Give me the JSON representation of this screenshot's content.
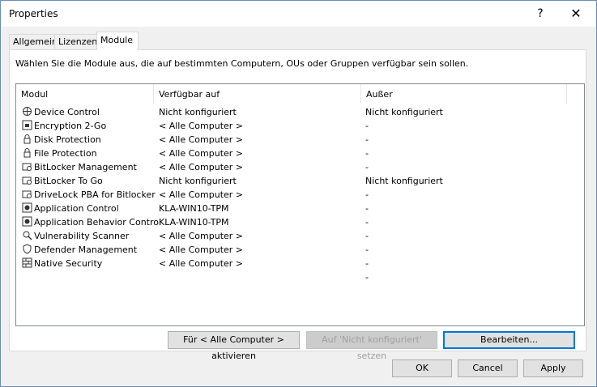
{
  "window": {
    "title": "Properties",
    "help_label": "?",
    "close_label": "✕"
  },
  "tabs": [
    {
      "label": "Allgemein",
      "active": false
    },
    {
      "label": "Lizenzen",
      "active": false
    },
    {
      "label": "Module",
      "active": true
    }
  ],
  "panel": {
    "instruction": "Wählen Sie die Module aus, die auf bestimmten Computern, OUs oder Gruppen verfügbar sein sollen."
  },
  "list": {
    "columns": [
      "Modul",
      "Verfügbar auf",
      "Außer"
    ],
    "rows": [
      {
        "icon": "device-control-icon",
        "module": "Device Control",
        "available": "Nicht konfiguriert",
        "except": "Nicht konfiguriert"
      },
      {
        "icon": "encryption-icon",
        "module": "Encryption 2-Go",
        "available": "< Alle Computer >",
        "except": "-"
      },
      {
        "icon": "lock-icon",
        "module": "Disk Protection",
        "available": "< Alle Computer >",
        "except": "-"
      },
      {
        "icon": "lock-icon",
        "module": "File Protection",
        "available": "< Alle Computer >",
        "except": "-"
      },
      {
        "icon": "bitlocker-icon",
        "module": "BitLocker Management",
        "available": "< Alle Computer >",
        "except": "-"
      },
      {
        "icon": "bitlocker-icon",
        "module": "BitLocker To Go",
        "available": "Nicht konfiguriert",
        "except": "Nicht konfiguriert"
      },
      {
        "icon": "bitlocker-icon",
        "module": "DriveLock PBA for Bitlocker",
        "available": "< Alle Computer >",
        "except": "-"
      },
      {
        "icon": "app-control-icon",
        "module": "Application Control",
        "available": "KLA-WIN10-TPM",
        "except": "-"
      },
      {
        "icon": "app-control-icon",
        "module": "Application Behavior Control",
        "available": "KLA-WIN10-TPM",
        "except": "-"
      },
      {
        "icon": "scanner-icon",
        "module": "Vulnerability Scanner",
        "available": "< Alle Computer >",
        "except": "-"
      },
      {
        "icon": "shield-icon",
        "module": "Defender Management",
        "available": "< Alle Computer >",
        "except": "-"
      },
      {
        "icon": "firewall-icon",
        "module": "Native Security",
        "available": "< Alle Computer >",
        "except": "-"
      },
      {
        "icon": "",
        "module": "",
        "available": "",
        "except": "-"
      }
    ]
  },
  "actions": {
    "activate_all": "Für < Alle Computer > aktivieren",
    "set_not_configured": "Auf 'Nicht konfiguriert' setzen",
    "edit": "Bearbeiten..."
  },
  "footer": {
    "ok": "OK",
    "cancel": "Cancel",
    "apply": "Apply"
  },
  "colors": {
    "accent": "#0078d7",
    "window_border": "#6b8db3",
    "panel": "#ffffff",
    "face": "#f0f0f0"
  }
}
